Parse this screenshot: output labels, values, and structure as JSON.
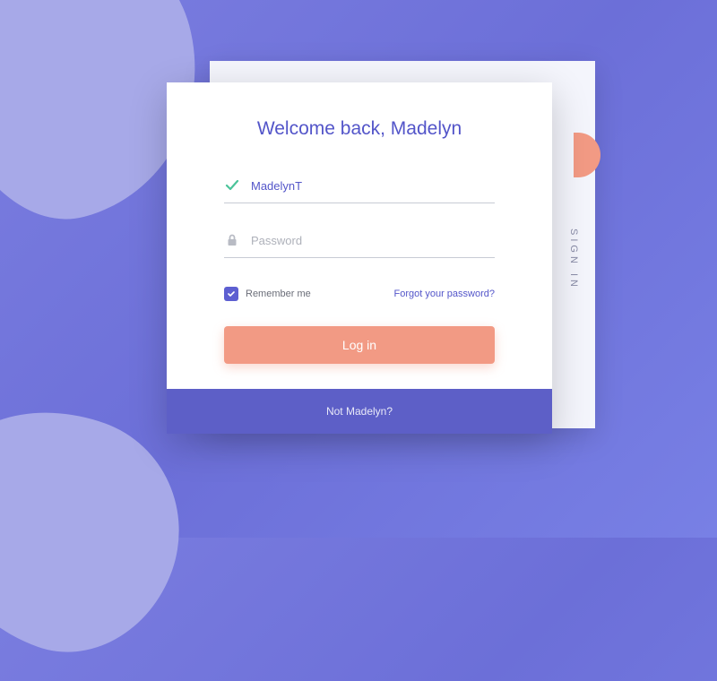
{
  "title": "Welcome back, Madelyn",
  "username": {
    "value": "MadelynT"
  },
  "password": {
    "placeholder": "Password"
  },
  "remember": {
    "label": "Remember me",
    "checked": true
  },
  "forgot_link": "Forgot your password?",
  "login_button": "Log in",
  "footer_link": "Not Madelyn?",
  "back_tab_label": "SIGN IN",
  "colors": {
    "primary": "#5d5fd1",
    "accent": "#f29a84",
    "bg": "#7b7ee0"
  }
}
